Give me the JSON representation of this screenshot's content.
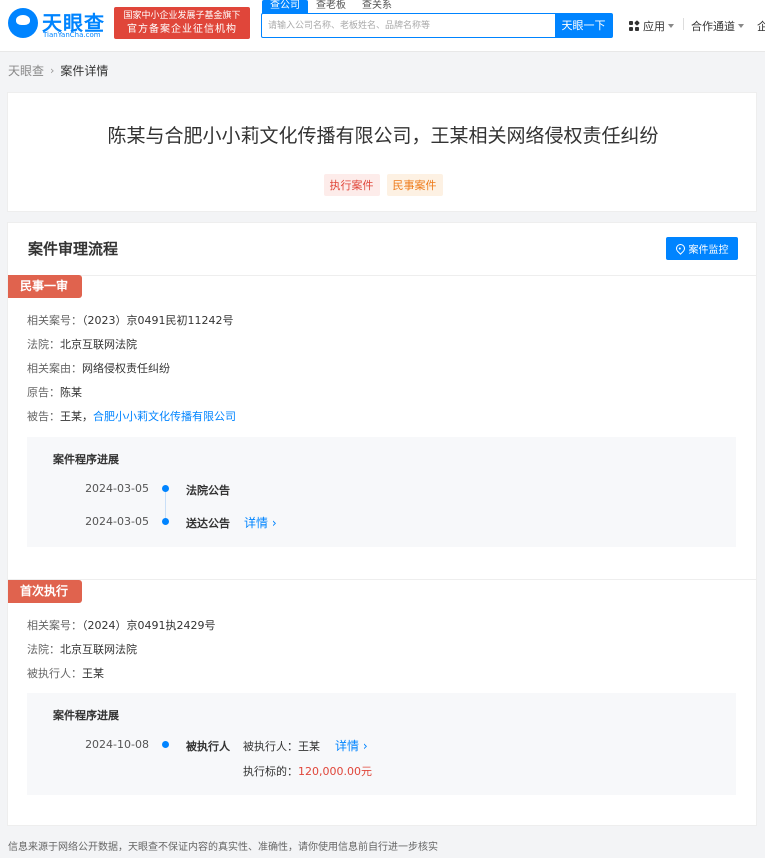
{
  "header": {
    "logo_name": "天眼查",
    "logo_sub": "TianYanCha.com",
    "badge_line1": "国家中小企业发展子基金旗下",
    "badge_line2": "官方备案企业征信机构",
    "search_tabs": [
      "查公司",
      "查老板",
      "查关系"
    ],
    "search_placeholder": "请输入公司名称、老板姓名、品牌名称等",
    "search_button": "天眼一下",
    "nav_apps": "应用",
    "nav_coop": "合作通道",
    "nav_more": "企"
  },
  "breadcrumb": {
    "home": "天眼查",
    "current": "案件详情"
  },
  "case": {
    "title": "陈某与合肥小小莉文化传播有限公司，王某相关网络侵权责任纠纷",
    "tags": [
      "执行案件",
      "民事案件"
    ]
  },
  "process": {
    "section_title": "案件审理流程",
    "monitor_button": "案件监控",
    "stages": [
      {
        "name": "民事一审",
        "fields": {
          "case_no_label": "相关案号：",
          "case_no": "（2023）京0491民初11242号",
          "court_label": "法院：",
          "court": "北京互联网法院",
          "cause_label": "相关案由：",
          "cause": "网络侵权责任纠纷",
          "plaintiff_label": "原告：",
          "plaintiff": "陈某",
          "defendant_label": "被告：",
          "defendant_person": "王某，",
          "defendant_company": "合肥小小莉文化传播有限公司"
        },
        "progress_title": "案件程序进展",
        "events": [
          {
            "date": "2024-03-05",
            "name": "法院公告"
          },
          {
            "date": "2024-03-05",
            "name": "送达公告",
            "detail": "详情"
          }
        ]
      },
      {
        "name": "首次执行",
        "fields": {
          "case_no_label": "相关案号：",
          "case_no": "（2024）京0491执2429号",
          "court_label": "法院：",
          "court": "北京互联网法院",
          "executed_label": "被执行人：",
          "executed": "王某"
        },
        "progress_title": "案件程序进展",
        "events": [
          {
            "date": "2024-10-08",
            "name": "被执行人",
            "info_label": "被执行人：",
            "info_value": "王某",
            "detail": "详情",
            "amount_label": "执行标的：",
            "amount": "120,000.00元"
          }
        ]
      }
    ]
  },
  "footer": {
    "disclaimer": "信息来源于网络公开数据，天眼查不保证内容的真实性、准确性，请你使用信息前自行进一步核实"
  },
  "colors": {
    "brand_blue": "#0084ff",
    "stage_red": "#e0634e",
    "amount_red": "#e0463a"
  }
}
